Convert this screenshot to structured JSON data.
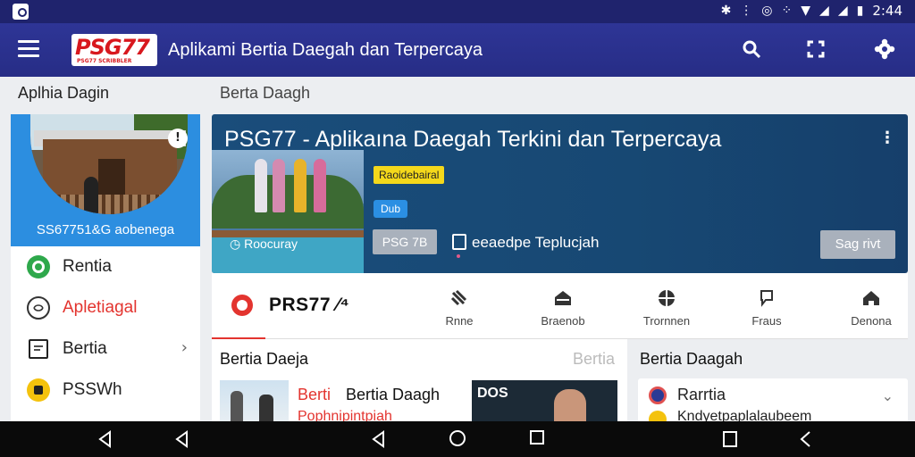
{
  "status_bar": {
    "time": "2:44",
    "icons": [
      "bluetooth-icon",
      "vibrate-icon",
      "sync-icon",
      "dots-icon",
      "wifi-icon",
      "signal-icon",
      "signal-icon",
      "battery-icon"
    ]
  },
  "app_bar": {
    "logo_text": "PSG77",
    "logo_subtext": "PSG77 SCRIBBLER",
    "title": "Aplikami Bertia Daegah dan Terpercaya",
    "icons": [
      "search-icon",
      "fullscreen-icon",
      "settings-icon"
    ]
  },
  "sidebar": {
    "header": "Aplhia Dagin",
    "profile_name": "SS67751&G aobenega",
    "profile_badge": "!",
    "items": [
      {
        "label": "Rentia",
        "icon": "globe-icon",
        "color": "#2ea84b"
      },
      {
        "label": "Apletiagal",
        "icon": "world-outline-icon",
        "color": "#e3342f"
      },
      {
        "label": "Bertia",
        "icon": "document-icon",
        "color": "#222222"
      },
      {
        "label": "PSSWh",
        "icon": "app-badge-icon",
        "color": "#f4c20d"
      }
    ]
  },
  "main": {
    "breadcrumb": "Berta Daagh",
    "hero": {
      "title": "PSG77 - Aplikaına Daegah Terkini dan Terpercaya",
      "caption": "Roocuray",
      "tag_yellow": "Raoidebairal",
      "tag_blue": "Dub",
      "button_small": "PSG 7B",
      "meta": "eeaedpe Teplucjah",
      "cta": "Sag rivt"
    },
    "categories": {
      "logo_label": "PRS77 ⁄⁴",
      "items": [
        {
          "label": "Rnne",
          "icon": "satellite-icon"
        },
        {
          "label": "Braenob",
          "icon": "home-icon"
        },
        {
          "label": "Trornnen",
          "icon": "ball-icon"
        },
        {
          "label": "Fraus",
          "icon": "chat-icon"
        },
        {
          "label": "Denona",
          "icon": "home-outline-icon"
        }
      ]
    },
    "news_left": {
      "title": "Bertia Daeja",
      "more": "Bertia",
      "headline_prefix": "Berti",
      "headline": "Bertia Daagh",
      "subline": "Pophnipintpiah",
      "thumb2_sign": "DOS"
    },
    "news_right": {
      "title": "Bertia Daagah",
      "item_label": "Rarrtia",
      "item_sub": "Kndyetpaplalaubeem"
    }
  },
  "nav_bar": {
    "buttons": [
      "back-icon",
      "back-icon",
      "back-icon",
      "home-circle-icon",
      "recents-icon",
      "recents-icon",
      "back-icon"
    ]
  }
}
